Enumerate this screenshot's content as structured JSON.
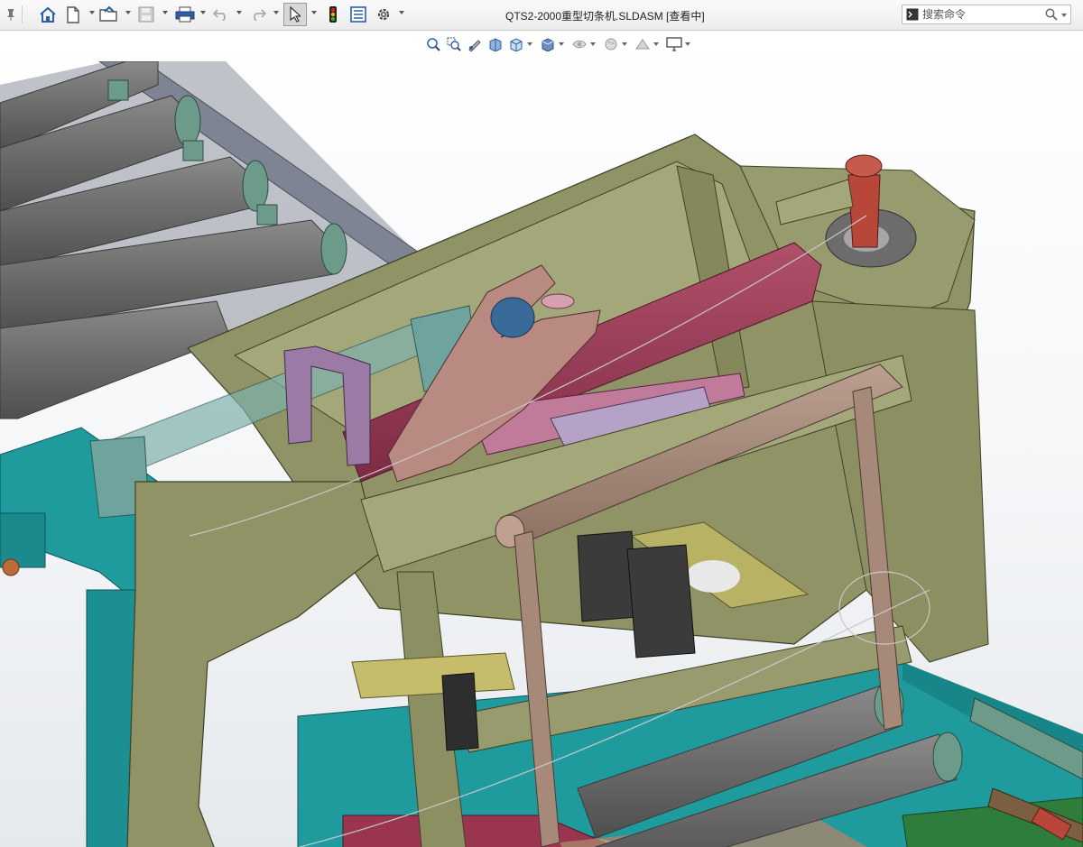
{
  "window": {
    "title": "QTS2-2000重型切条机.SLDASM [查看中]"
  },
  "search": {
    "placeholder": "搜索命令"
  },
  "toolbar": {
    "items": [
      "pin-icon",
      "home-icon",
      "new-document-icon",
      "open-folder-icon",
      "save-icon",
      "print-icon",
      "undo-icon",
      "redo-icon",
      "select-pointer-icon",
      "rebuild-traffic-light-icon",
      "file-properties-icon",
      "options-gear-icon"
    ]
  },
  "headsup_toolbar": {
    "items": [
      "zoom-to-fit-icon",
      "zoom-to-area-icon",
      "previous-view-icon",
      "section-view-icon",
      "view-orientation-icon",
      "display-style-icon",
      "hide-show-items-icon",
      "edit-appearance-icon",
      "apply-scene-icon",
      "view-settings-icon"
    ]
  },
  "colors": {
    "frame_olive": "#8f9365",
    "frame_olive_light": "#a4a77a",
    "conveyor_teal": "#1f9b9e",
    "roller_gray": "#6e6e6e",
    "cylinder_crimson": "#9a3550",
    "arm_pink": "#b98a82",
    "guide_purple": "#9c7aa6",
    "block_glass": "#7fb1ac",
    "cutter_yellow": "#b8b265",
    "pad_dark": "#3b3b3b",
    "tan_roller": "#a7897a",
    "green_base": "#2f7d3c"
  }
}
